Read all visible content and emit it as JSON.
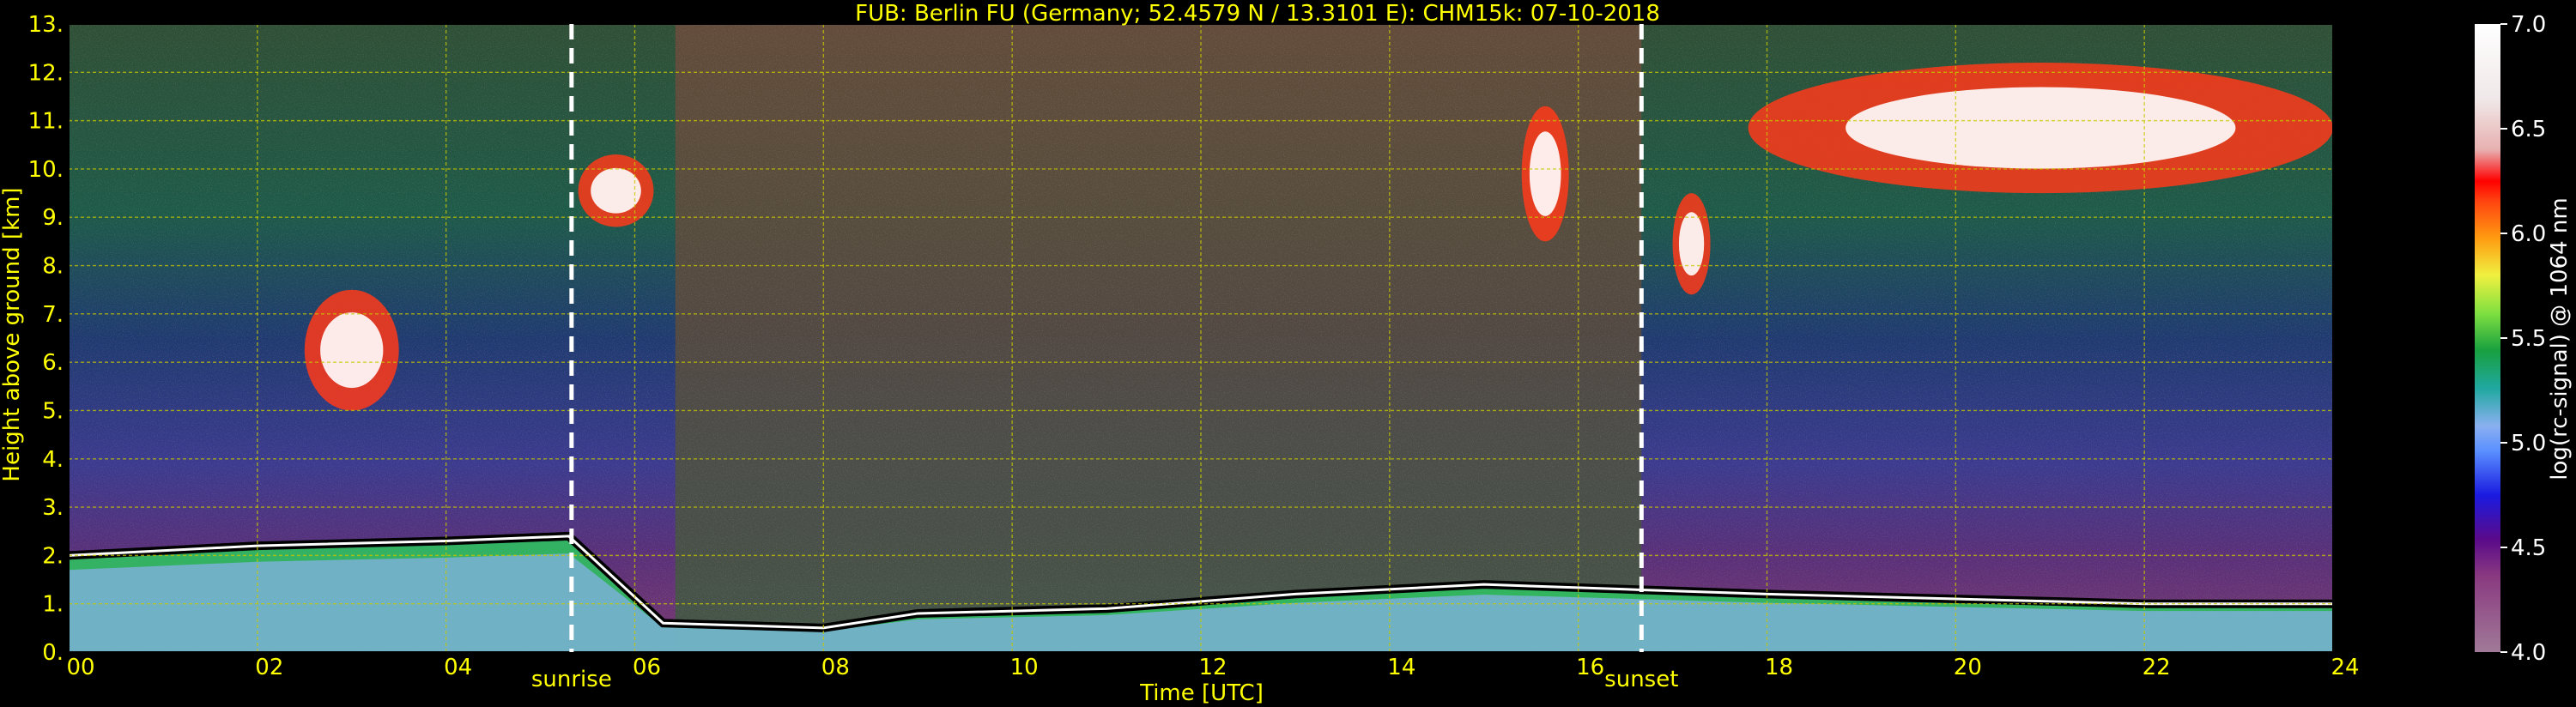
{
  "chart_data": {
    "type": "heatmap",
    "title": "FUB: Berlin FU (Germany; 52.4579 N / 13.3101 E):    CHM15k: 07-10-2018",
    "xlabel": "Time [UTC]",
    "ylabel": "Height above ground [km]",
    "xlim": [
      0,
      24
    ],
    "ylim": [
      0,
      13
    ],
    "x_ticks": [
      "00",
      "02",
      "04",
      "06",
      "08",
      "10",
      "12",
      "14",
      "16",
      "18",
      "20",
      "22",
      "24"
    ],
    "y_ticks": [
      "0.",
      "1.",
      "2.",
      "3.",
      "4.",
      "5.",
      "6.",
      "7.",
      "8.",
      "9.",
      "10.",
      "11.",
      "12.",
      "13."
    ],
    "grid": true,
    "colorbar": {
      "label": "log(rc-signal) @ 1064 nm",
      "range": [
        4.0,
        7.0
      ],
      "ticks": [
        "4.0",
        "4.5",
        "5.0",
        "5.5",
        "6.0",
        "6.5",
        "7.0"
      ]
    },
    "events": [
      {
        "label": "sunrise",
        "x": 5.33
      },
      {
        "label": "sunset",
        "x": 16.67
      }
    ],
    "boundary_layer_top_km": [
      {
        "x": 0,
        "y": 2.0
      },
      {
        "x": 2,
        "y": 2.2
      },
      {
        "x": 4,
        "y": 2.3
      },
      {
        "x": 5.3,
        "y": 2.4
      },
      {
        "x": 6.3,
        "y": 0.6
      },
      {
        "x": 8,
        "y": 0.5
      },
      {
        "x": 9,
        "y": 0.8
      },
      {
        "x": 11,
        "y": 0.9
      },
      {
        "x": 13,
        "y": 1.2
      },
      {
        "x": 15,
        "y": 1.4
      },
      {
        "x": 16.5,
        "y": 1.3
      },
      {
        "x": 18,
        "y": 1.2
      },
      {
        "x": 20,
        "y": 1.1
      },
      {
        "x": 22,
        "y": 1.0
      },
      {
        "x": 24,
        "y": 1.0
      }
    ],
    "cloud_layers": [
      {
        "x_start": 2.5,
        "x_end": 3.5,
        "y_bottom": 5.0,
        "y_top": 7.5
      },
      {
        "x_start": 5.4,
        "x_end": 6.2,
        "y_bottom": 8.8,
        "y_top": 10.3
      },
      {
        "x_start": 15.4,
        "x_end": 15.9,
        "y_bottom": 8.5,
        "y_top": 11.3
      },
      {
        "x_start": 17.0,
        "x_end": 17.4,
        "y_bottom": 7.4,
        "y_top": 9.5
      },
      {
        "x_start": 17.8,
        "x_end": 24.0,
        "y_bottom": 9.5,
        "y_top": 12.2
      }
    ]
  },
  "colors": {
    "axis_text": "#ffff00",
    "grid": "#c8c800",
    "event_line": "#ffffff"
  }
}
